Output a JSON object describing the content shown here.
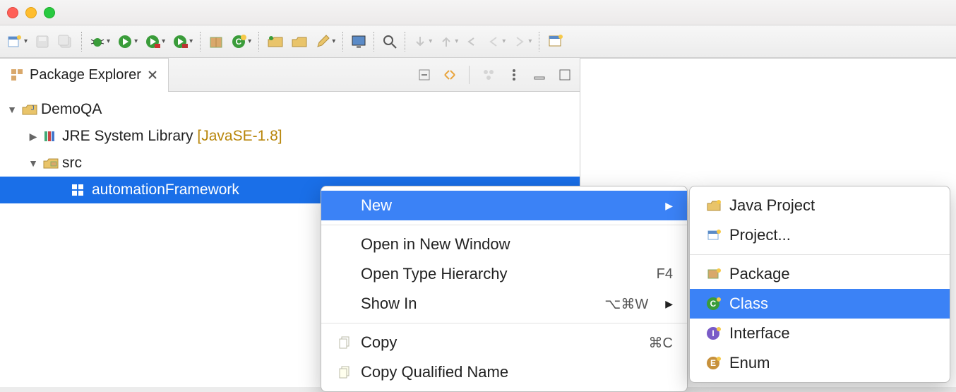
{
  "explorer": {
    "title": "Package Explorer",
    "tree": {
      "project": "DemoQA",
      "jre_label": "JRE System Library",
      "jre_tag": "[JavaSE-1.8]",
      "src": "src",
      "package": "automationFramework"
    }
  },
  "context_menu": {
    "new": "New",
    "open_new_window": "Open in New Window",
    "open_type_hierarchy": "Open Type Hierarchy",
    "open_type_hierarchy_sc": "F4",
    "show_in": "Show In",
    "show_in_sc": "⌥⌘W",
    "copy": "Copy",
    "copy_sc": "⌘C",
    "copy_qualified": "Copy Qualified Name"
  },
  "submenu": {
    "java_project": "Java Project",
    "project": "Project...",
    "package": "Package",
    "class": "Class",
    "interface": "Interface",
    "enum": "Enum"
  }
}
